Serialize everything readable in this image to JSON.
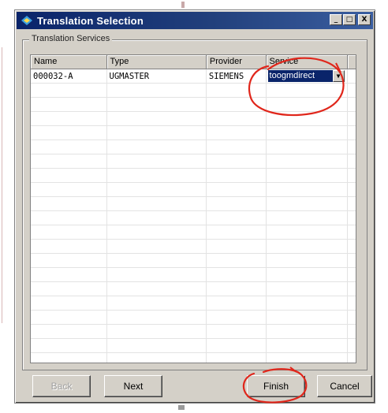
{
  "window": {
    "title": "Translation Selection",
    "controls": {
      "minimize": "_",
      "maximize": "□",
      "close": "X"
    }
  },
  "group": {
    "label": "Translation Services"
  },
  "table": {
    "headers": [
      "Name",
      "Type",
      "Provider",
      "Service"
    ],
    "rows": [
      {
        "name": "000032-A",
        "type": "UGMASTER",
        "provider": "SIEMENS",
        "service": "toogmdirect"
      }
    ]
  },
  "buttons": {
    "back": "Back",
    "next": "Next",
    "finish": "Finish",
    "cancel": "Cancel"
  },
  "colors": {
    "selection": "#0a246a",
    "annotation": "#e0261b",
    "titlebar": "#0a246a"
  }
}
